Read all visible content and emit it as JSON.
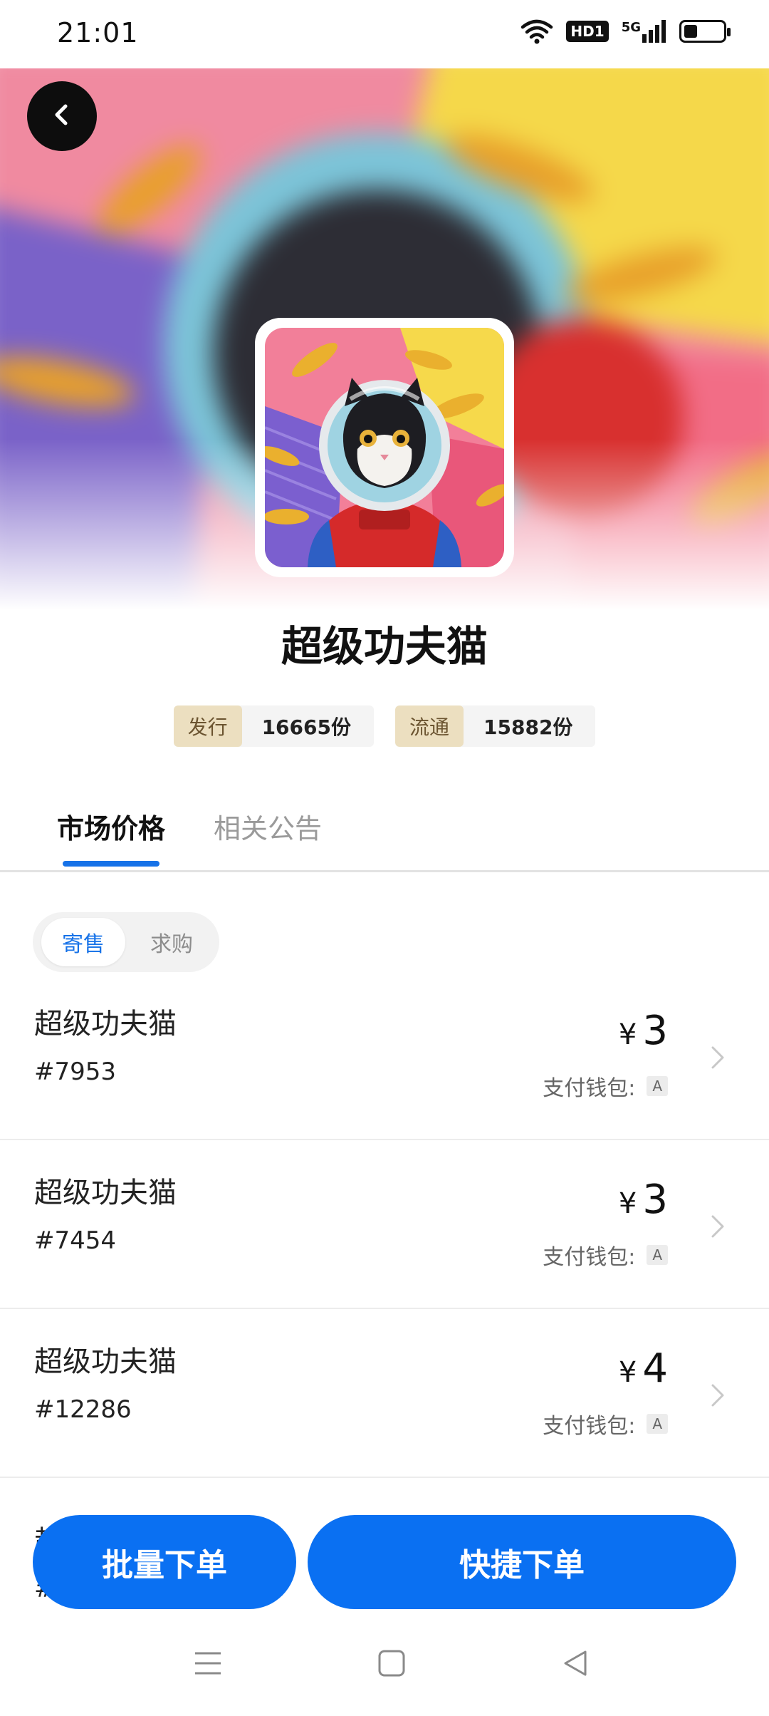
{
  "status_bar": {
    "time": "21:01",
    "network_badge": "HD1",
    "signal_label": "5G",
    "battery_level": 0.35
  },
  "hero": {
    "back_icon": "chevron-left-icon",
    "artwork": "astronaut-cat-artwork"
  },
  "collection": {
    "title": "超级功夫猫",
    "issued_label": "发行",
    "issued_value": "16665份",
    "circulation_label": "流通",
    "circulation_value": "15882份"
  },
  "tabs": [
    {
      "label": "市场价格",
      "active": true
    },
    {
      "label": "相关公告",
      "active": false
    }
  ],
  "segment": {
    "options": [
      "寄售",
      "求购"
    ],
    "selected": "寄售"
  },
  "listings": [
    {
      "name": "超级功夫猫",
      "serial": "#7953",
      "currency": "¥",
      "price": "3",
      "wallet_label": "支付钱包:",
      "wallet_badge": "A"
    },
    {
      "name": "超级功夫猫",
      "serial": "#7454",
      "currency": "¥",
      "price": "3",
      "wallet_label": "支付钱包:",
      "wallet_badge": "A"
    },
    {
      "name": "超级功夫猫",
      "serial": "#12286",
      "currency": "¥",
      "price": "4",
      "wallet_label": "支付钱包:",
      "wallet_badge": "A"
    }
  ],
  "partial_listing": {
    "name": "超",
    "serial": "#1"
  },
  "actions": {
    "batch_order": "批量下单",
    "quick_order": "快捷下单"
  },
  "colors": {
    "accent": "#1672e8",
    "button": "#0a70f2",
    "stat_label_bg": "#ecdfc0"
  },
  "nav": {
    "menu_icon": "menu-icon",
    "home_icon": "home-square-icon",
    "back_icon": "back-triangle-icon"
  }
}
